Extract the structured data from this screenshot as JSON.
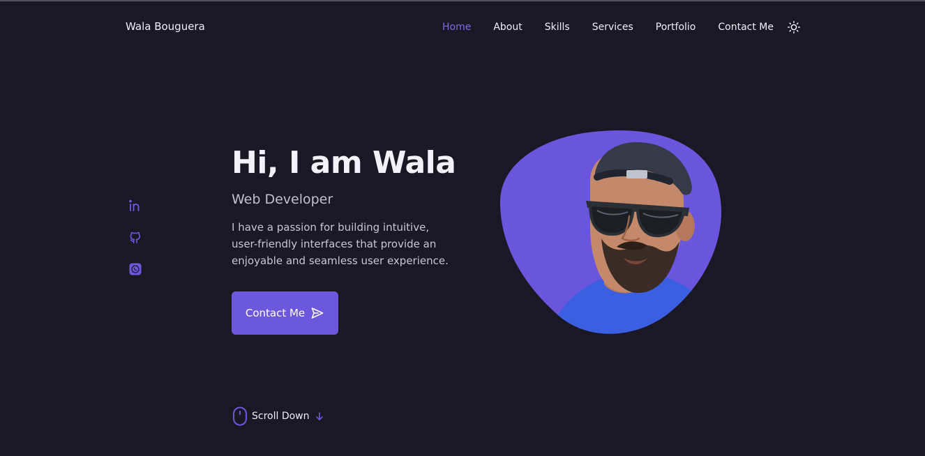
{
  "header": {
    "logo": "Wala Bouguera",
    "nav": [
      {
        "label": "Home"
      },
      {
        "label": "About"
      },
      {
        "label": "Skills"
      },
      {
        "label": "Services"
      },
      {
        "label": "Portfolio"
      },
      {
        "label": "Contact Me"
      }
    ],
    "active_nav": "Home",
    "theme_toggle_icon": "sun-icon"
  },
  "social": [
    {
      "icon": "linkedin-icon"
    },
    {
      "icon": "github-icon"
    },
    {
      "icon": "whatsapp-icon"
    }
  ],
  "hero": {
    "title": "Hi, I am Wala",
    "subtitle": "Web Developer",
    "description_lines": [
      "I have a passion for building intuitive,",
      "user-friendly interfaces that provide an",
      "enjoyable and seamless user experience."
    ],
    "cta_label": "Contact Me",
    "cta_icon": "send-icon",
    "image_icon": "profile-photo"
  },
  "scroll": {
    "label": "Scroll Down",
    "icon": "mouse-icon",
    "arrow_icon": "arrow-down-icon"
  },
  "colors": {
    "background": "#1b1826",
    "accent": "#6c58dc",
    "accent_text": "#7c6ae8",
    "blob": "#6a56dd",
    "shirt": "#3a5fe0"
  }
}
